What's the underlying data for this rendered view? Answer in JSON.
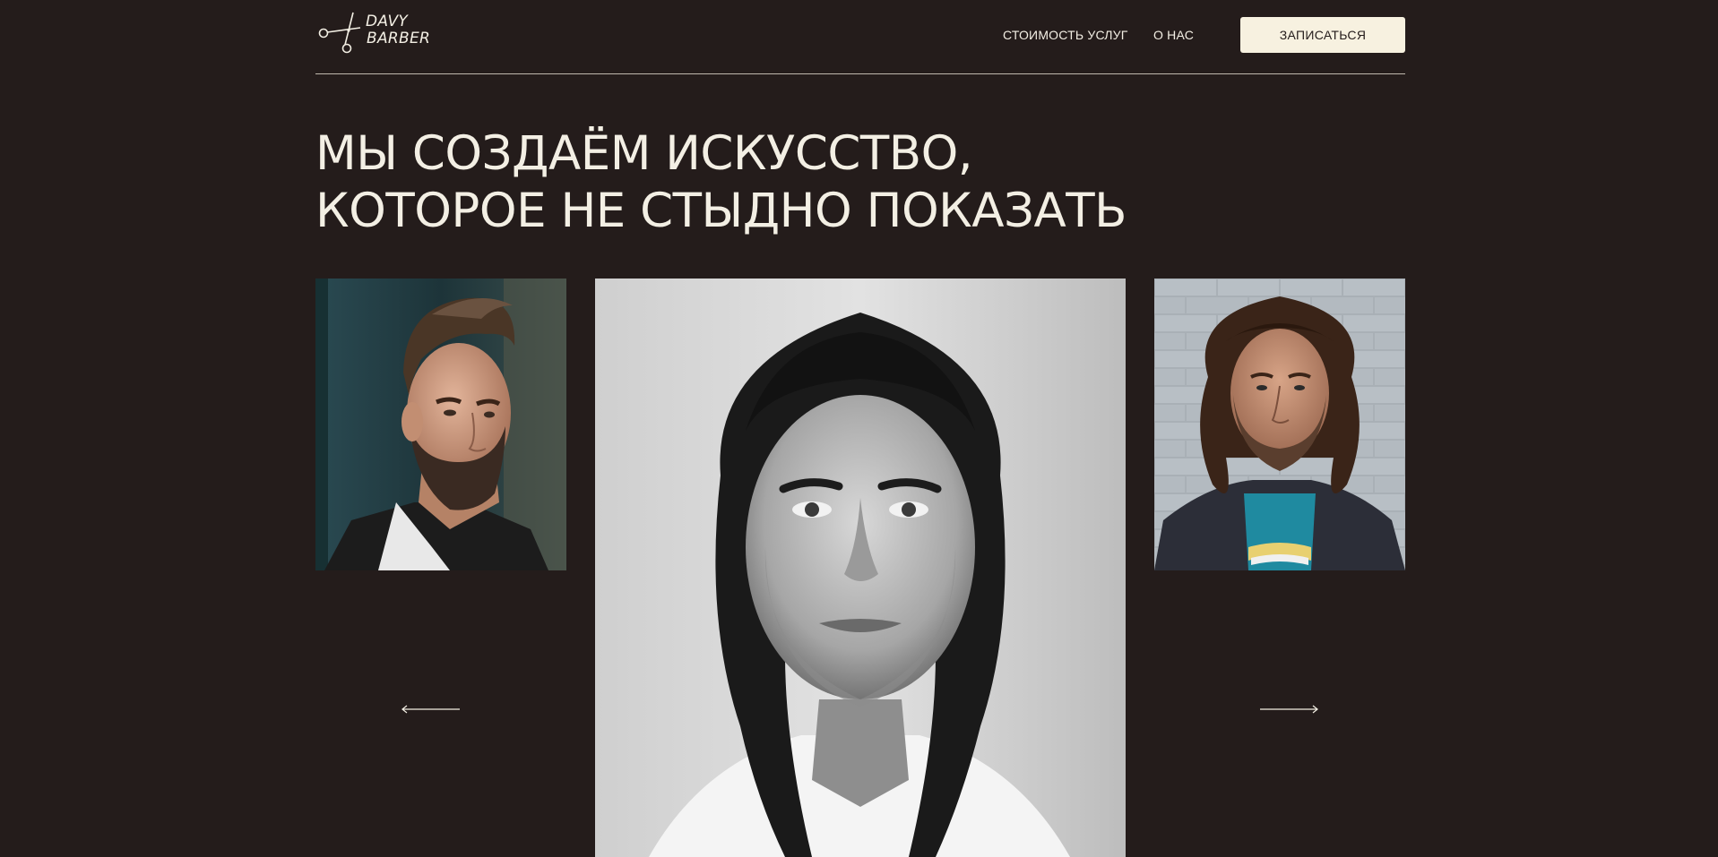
{
  "brand": {
    "line1": "DAVY",
    "line2": "BARBER",
    "icon": "scissors-icon"
  },
  "nav": {
    "services": "СТОИМОСТЬ УСЛУГ",
    "about": "О НАС"
  },
  "header": {
    "book_label": "ЗАПИСАТЬСЯ"
  },
  "hero": {
    "title_line1": "МЫ СОЗДАЁМ ИСКУССТВО,",
    "title_line2": "КОТОРОЕ НЕ СТЫДНО ПОКАЗАТЬ"
  },
  "gallery": {
    "prev_icon": "arrow-left-icon",
    "next_icon": "arrow-right-icon"
  },
  "colors": {
    "background": "#241c1b",
    "text": "#f3efe4",
    "button_bg": "#f7f1e0",
    "button_text": "#241c1b",
    "divider": "#bfb8ad"
  }
}
